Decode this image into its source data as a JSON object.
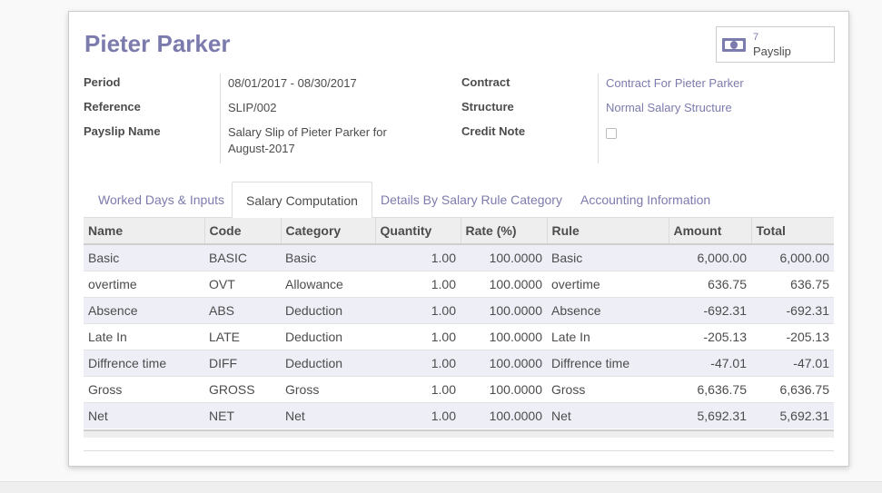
{
  "record": {
    "title": "Pieter Parker"
  },
  "smart_button": {
    "value": "7",
    "label": "Payslip",
    "icon": "money-icon"
  },
  "fields": {
    "period_label": "Period",
    "period_value": "08/01/2017 - 08/30/2017",
    "reference_label": "Reference",
    "reference_value": "SLIP/002",
    "payslip_name_label": "Payslip Name",
    "payslip_name_line1": "Salary Slip of Pieter Parker for",
    "payslip_name_line2": "August-2017",
    "contract_label": "Contract",
    "contract_value": "Contract For Pieter Parker",
    "structure_label": "Structure",
    "structure_value": "Normal Salary Structure",
    "credit_note_label": "Credit Note",
    "credit_note_checked": false
  },
  "tabs": [
    {
      "label": "Worked Days & Inputs",
      "active": false
    },
    {
      "label": "Salary Computation",
      "active": true
    },
    {
      "label": "Details By Salary Rule Category",
      "active": false
    },
    {
      "label": "Accounting Information",
      "active": false
    }
  ],
  "table": {
    "columns": [
      "Name",
      "Code",
      "Category",
      "Quantity",
      "Rate (%)",
      "Rule",
      "Amount",
      "Total"
    ],
    "rows": [
      [
        "Basic",
        "BASIC",
        "Basic",
        "1.00",
        "100.0000",
        "Basic",
        "6,000.00",
        "6,000.00"
      ],
      [
        "overtime",
        "OVT",
        "Allowance",
        "1.00",
        "100.0000",
        "overtime",
        "636.75",
        "636.75"
      ],
      [
        "Absence",
        "ABS",
        "Deduction",
        "1.00",
        "100.0000",
        "Absence",
        "-692.31",
        "-692.31"
      ],
      [
        "Late In",
        "LATE",
        "Deduction",
        "1.00",
        "100.0000",
        "Late In",
        "-205.13",
        "-205.13"
      ],
      [
        "Diffrence time",
        "DIFF",
        "Deduction",
        "1.00",
        "100.0000",
        "Diffrence time",
        "-47.01",
        "-47.01"
      ],
      [
        "Gross",
        "GROSS",
        "Gross",
        "1.00",
        "100.0000",
        "Gross",
        "6,636.75",
        "6,636.75"
      ],
      [
        "Net",
        "NET",
        "Net",
        "1.00",
        "100.0000",
        "Net",
        "5,692.31",
        "5,692.31"
      ]
    ]
  },
  "colors": {
    "accent": "#7c7bad",
    "row_stripe": "#eeeef7",
    "header_bg": "#eeeeee"
  }
}
